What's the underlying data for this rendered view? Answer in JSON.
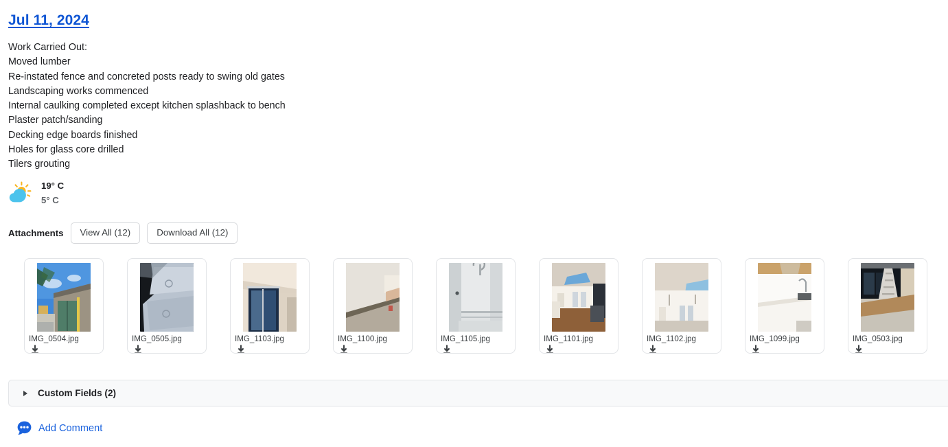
{
  "entry": {
    "title": "Jul 11, 2024",
    "title_color": "#1056d4",
    "notes": [
      "Work Carried Out:",
      "Moved lumber",
      "Re-instated fence and concreted posts ready to swing old gates",
      "Landscaping works commenced",
      "Internal caulking completed except kitchen splashback to bench",
      "Plaster patch/sanding",
      "Decking edge boards finished",
      "Holes for glass core drilled",
      "Tilers grouting"
    ]
  },
  "weather": {
    "icon": "sun-behind-cloud-icon",
    "high": "19° C",
    "low": "5° C",
    "sun_color": "#f9b522",
    "cloud_color": "#4cc3ec"
  },
  "attachments": {
    "label": "Attachments",
    "view_all_label": "View All (12)",
    "download_all_label": "Download All (12)",
    "count": 12,
    "items": [
      {
        "name": "IMG_0504.jpg",
        "download_icon": "download-icon"
      },
      {
        "name": "IMG_0505.jpg",
        "download_icon": "download-icon"
      },
      {
        "name": "IMG_1103.jpg",
        "download_icon": "download-icon"
      },
      {
        "name": "IMG_1100.jpg",
        "download_icon": "download-icon"
      },
      {
        "name": "IMG_1105.jpg",
        "download_icon": "download-icon"
      },
      {
        "name": "IMG_1101.jpg",
        "download_icon": "download-icon"
      },
      {
        "name": "IMG_1102.jpg",
        "download_icon": "download-icon"
      },
      {
        "name": "IMG_1099.jpg",
        "download_icon": "download-icon"
      },
      {
        "name": "IMG_0503.jpg",
        "download_icon": "download-icon"
      }
    ]
  },
  "custom_fields": {
    "label": "Custom Fields (2)",
    "expand_icon": "triangle-right-icon",
    "expanded": false
  },
  "comment": {
    "label": "Add Comment",
    "icon": "comment-bubble-icon",
    "color": "#1a62dd"
  }
}
